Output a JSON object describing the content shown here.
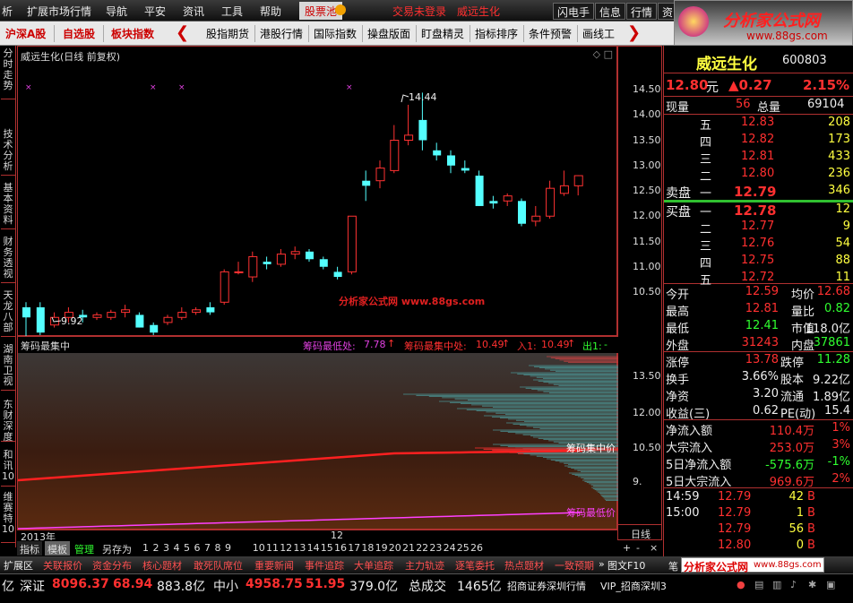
{
  "menubar": {
    "items": [
      "析",
      "扩展市场行情",
      "导航",
      "平安",
      "资讯",
      "工具",
      "帮助"
    ],
    "active": "股票池",
    "status_login": "交易未登录",
    "status_stock": "威远生化",
    "buttons": [
      "闪电手",
      "信息",
      "行情",
      "资"
    ]
  },
  "toolbar": {
    "left": [
      "沪深A股",
      "自选股",
      "板块指数"
    ],
    "items": [
      "股指期货",
      "港股行情",
      "国际指数",
      "操盘版面",
      "盯盘精灵",
      "指标排序",
      "条件预警",
      "画线工"
    ]
  },
  "logo": {
    "text": "分析家公式网",
    "url": "www.88gs.com"
  },
  "lefttabs": [
    "分时走势",
    "技术分析",
    "基本资料",
    "财务透视",
    "天龙八部",
    "湖南卫视",
    "东财深度",
    "和讯10",
    "维赛特10"
  ],
  "kchart": {
    "title": "威远生化(日线 前复权)",
    "high_label": "14.44",
    "low_label": "9.92",
    "watermark": "分析家公式网 www.88gs.com",
    "yticks": [
      "14.50",
      "14.00",
      "13.50",
      "13.00",
      "12.50",
      "12.00",
      "11.50",
      "11.00",
      "10.50"
    ]
  },
  "chip": {
    "title": "筹码最集中",
    "low_label": "筹码最低处:",
    "low_value": "7.78",
    "mid_label": "筹码最集中处:",
    "mid_value": "10.49",
    "in_label": "入1:",
    "in_value": "10.49",
    "out_label": "出1:",
    "out_value": "-",
    "line1": "筹码集中价",
    "line2": "筹码最低价",
    "yticks": [
      "13.50",
      "12.00",
      "10.50",
      "9."
    ]
  },
  "xaxis": {
    "year": "2013年",
    "mark": "12",
    "period": "日线"
  },
  "bottomtabs": {
    "labels": [
      "指标",
      "模板",
      "管理",
      "另存为"
    ],
    "numbers": [
      "1",
      "2",
      "3",
      "4",
      "5",
      "6",
      "7",
      "8",
      "9",
      "10",
      "11",
      "12",
      "13",
      "14",
      "15",
      "16",
      "17",
      "18",
      "19",
      "20",
      "21",
      "22",
      "23",
      "24",
      "25",
      "26"
    ]
  },
  "quote": {
    "name": "威远生化",
    "code": "600803",
    "price": "12.80",
    "unit": "元",
    "change": "▲0.27",
    "pct": "2.15%",
    "vol_label": "现量",
    "vol": "56",
    "total_label": "总量",
    "total": "69104",
    "sell": [
      {
        "l": "五",
        "p": "12.83",
        "v": "208"
      },
      {
        "l": "四",
        "p": "12.82",
        "v": "173"
      },
      {
        "l": "三",
        "p": "12.81",
        "v": "433"
      },
      {
        "l": "二",
        "p": "12.80",
        "v": "236"
      },
      {
        "l": "一",
        "p": "12.79",
        "v": "346"
      }
    ],
    "sell_label": "卖盘",
    "buy_label": "买盘",
    "buy": [
      {
        "l": "一",
        "p": "12.78",
        "v": "12"
      },
      {
        "l": "二",
        "p": "12.77",
        "v": "9"
      },
      {
        "l": "三",
        "p": "12.76",
        "v": "54"
      },
      {
        "l": "四",
        "p": "12.75",
        "v": "88"
      },
      {
        "l": "五",
        "p": "12.72",
        "v": "11"
      }
    ],
    "stats": [
      [
        "今开",
        "12.59",
        "均价",
        "12.68"
      ],
      [
        "最高",
        "12.81",
        "量比",
        "0.82"
      ],
      [
        "最低",
        "12.41",
        "市值",
        "118.0亿"
      ],
      [
        "外盘",
        "31243",
        "内盘",
        "37861"
      ]
    ],
    "stats2": [
      [
        "涨停",
        "13.78",
        "跌停",
        "11.28"
      ],
      [
        "换手",
        "3.66%",
        "股本",
        "9.22亿"
      ],
      [
        "净资",
        "3.20",
        "流通",
        "1.89亿"
      ],
      [
        "收益(三)",
        "0.62",
        "PE(动)",
        "15.4"
      ]
    ],
    "flow": [
      [
        "净流入额",
        "110.4万",
        "1%"
      ],
      [
        "大宗流入",
        "253.0万",
        "3%"
      ],
      [
        "5日净流入额",
        "-575.6万",
        "-1%"
      ],
      [
        "5日大宗流入",
        "969.6万",
        "2%"
      ]
    ],
    "ticks": [
      [
        "14:59",
        "12.79",
        "42",
        "B"
      ],
      [
        "15:00",
        "12.79",
        "1",
        "B"
      ],
      [
        "",
        "12.79",
        "56",
        "B"
      ],
      [
        "",
        "12.80",
        "0",
        "B"
      ]
    ]
  },
  "funcbar": [
    "扩展区",
    "关联报价",
    "资金分布",
    "核心题材",
    "敢死队席位",
    "重要新闻",
    "事件追踪",
    "大单追踪",
    "主力轨迹",
    "逐笔委托",
    "热点题材",
    "一致预期",
    "图文F10"
  ],
  "funcbar_right": "笔",
  "statusbar": {
    "a": "亿",
    "sz_label": "深证",
    "sz": "8096.37",
    "sz_chg": "68.94",
    "sz_amt": "883.8亿",
    "zx_label": "中小",
    "zx": "4958.75",
    "zx_chg": "51.95",
    "zx_amt": "379.0亿",
    "total_label": "总成交",
    "total": "1465亿",
    "broker": "招商证券深圳行情",
    "vip": "VIP_招商深圳3"
  },
  "colors": {
    "up": "#ff3232",
    "down": "#54ffff",
    "bg": "#000000",
    "border": "#b03030"
  }
}
